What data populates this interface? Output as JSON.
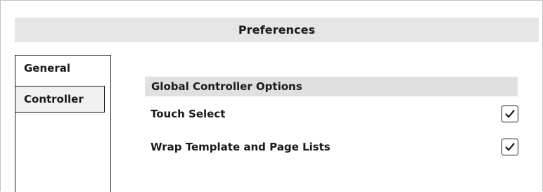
{
  "window": {
    "title": "Preferences"
  },
  "tabs": [
    {
      "label": "General",
      "selected": true
    },
    {
      "label": "Controller",
      "selected": false
    }
  ],
  "section": {
    "header": "Global Controller Options"
  },
  "options": [
    {
      "label": "Touch Select",
      "checked": true,
      "icon": "check-icon"
    },
    {
      "label": "Wrap Template and Page Lists",
      "checked": true,
      "icon": "check-icon"
    }
  ],
  "colors": {
    "titlebar_bg": "#e5e5e5",
    "section_bg": "#e0e0e0",
    "text": "#1a1a1a",
    "inactive_tab_bg": "#f0f0f0"
  }
}
